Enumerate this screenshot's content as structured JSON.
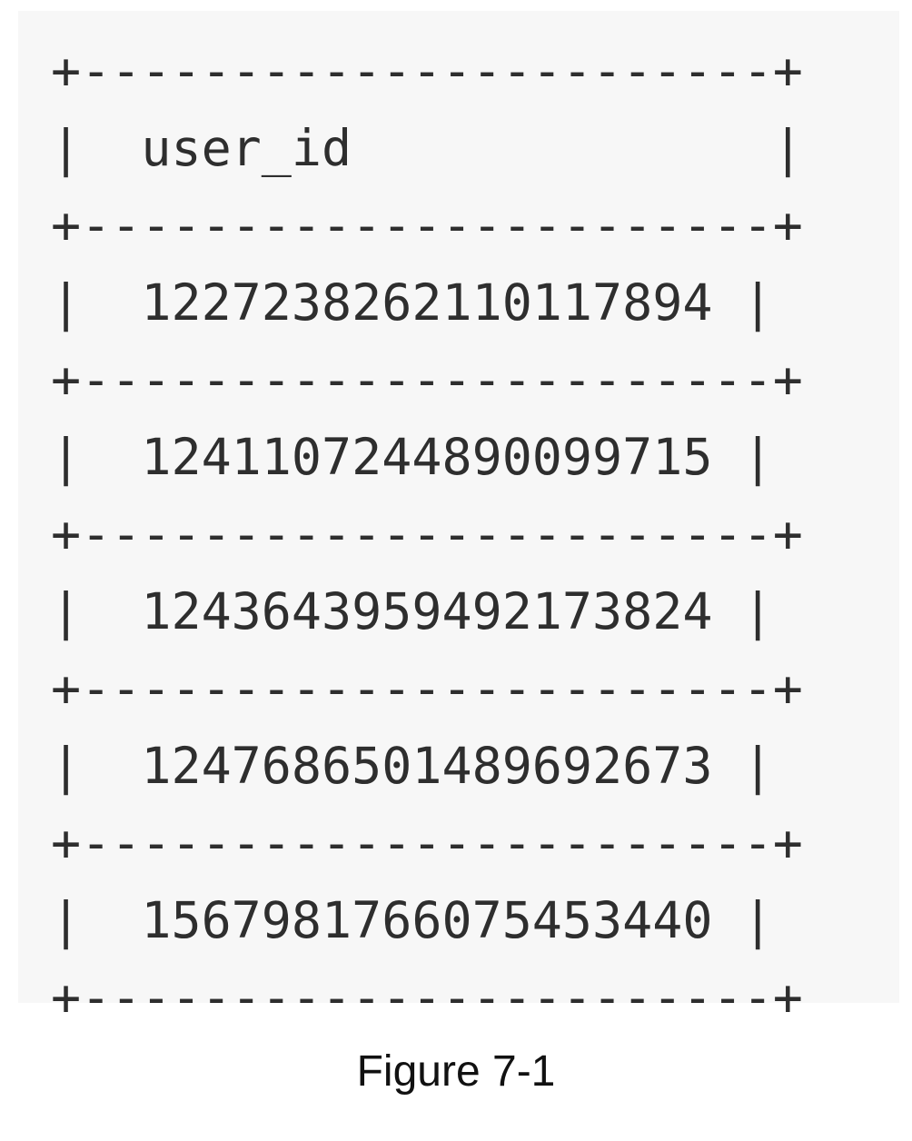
{
  "table": {
    "border": "+-----------------------+",
    "rows": [
      "|  user_id              |",
      "|  1227238262110117894 |",
      "|  1241107244890099715 |",
      "|  1243643959492173824 |",
      "|  1247686501489692673 |",
      "|  1567981766075453440 |"
    ]
  },
  "caption": "Figure 7-1"
}
